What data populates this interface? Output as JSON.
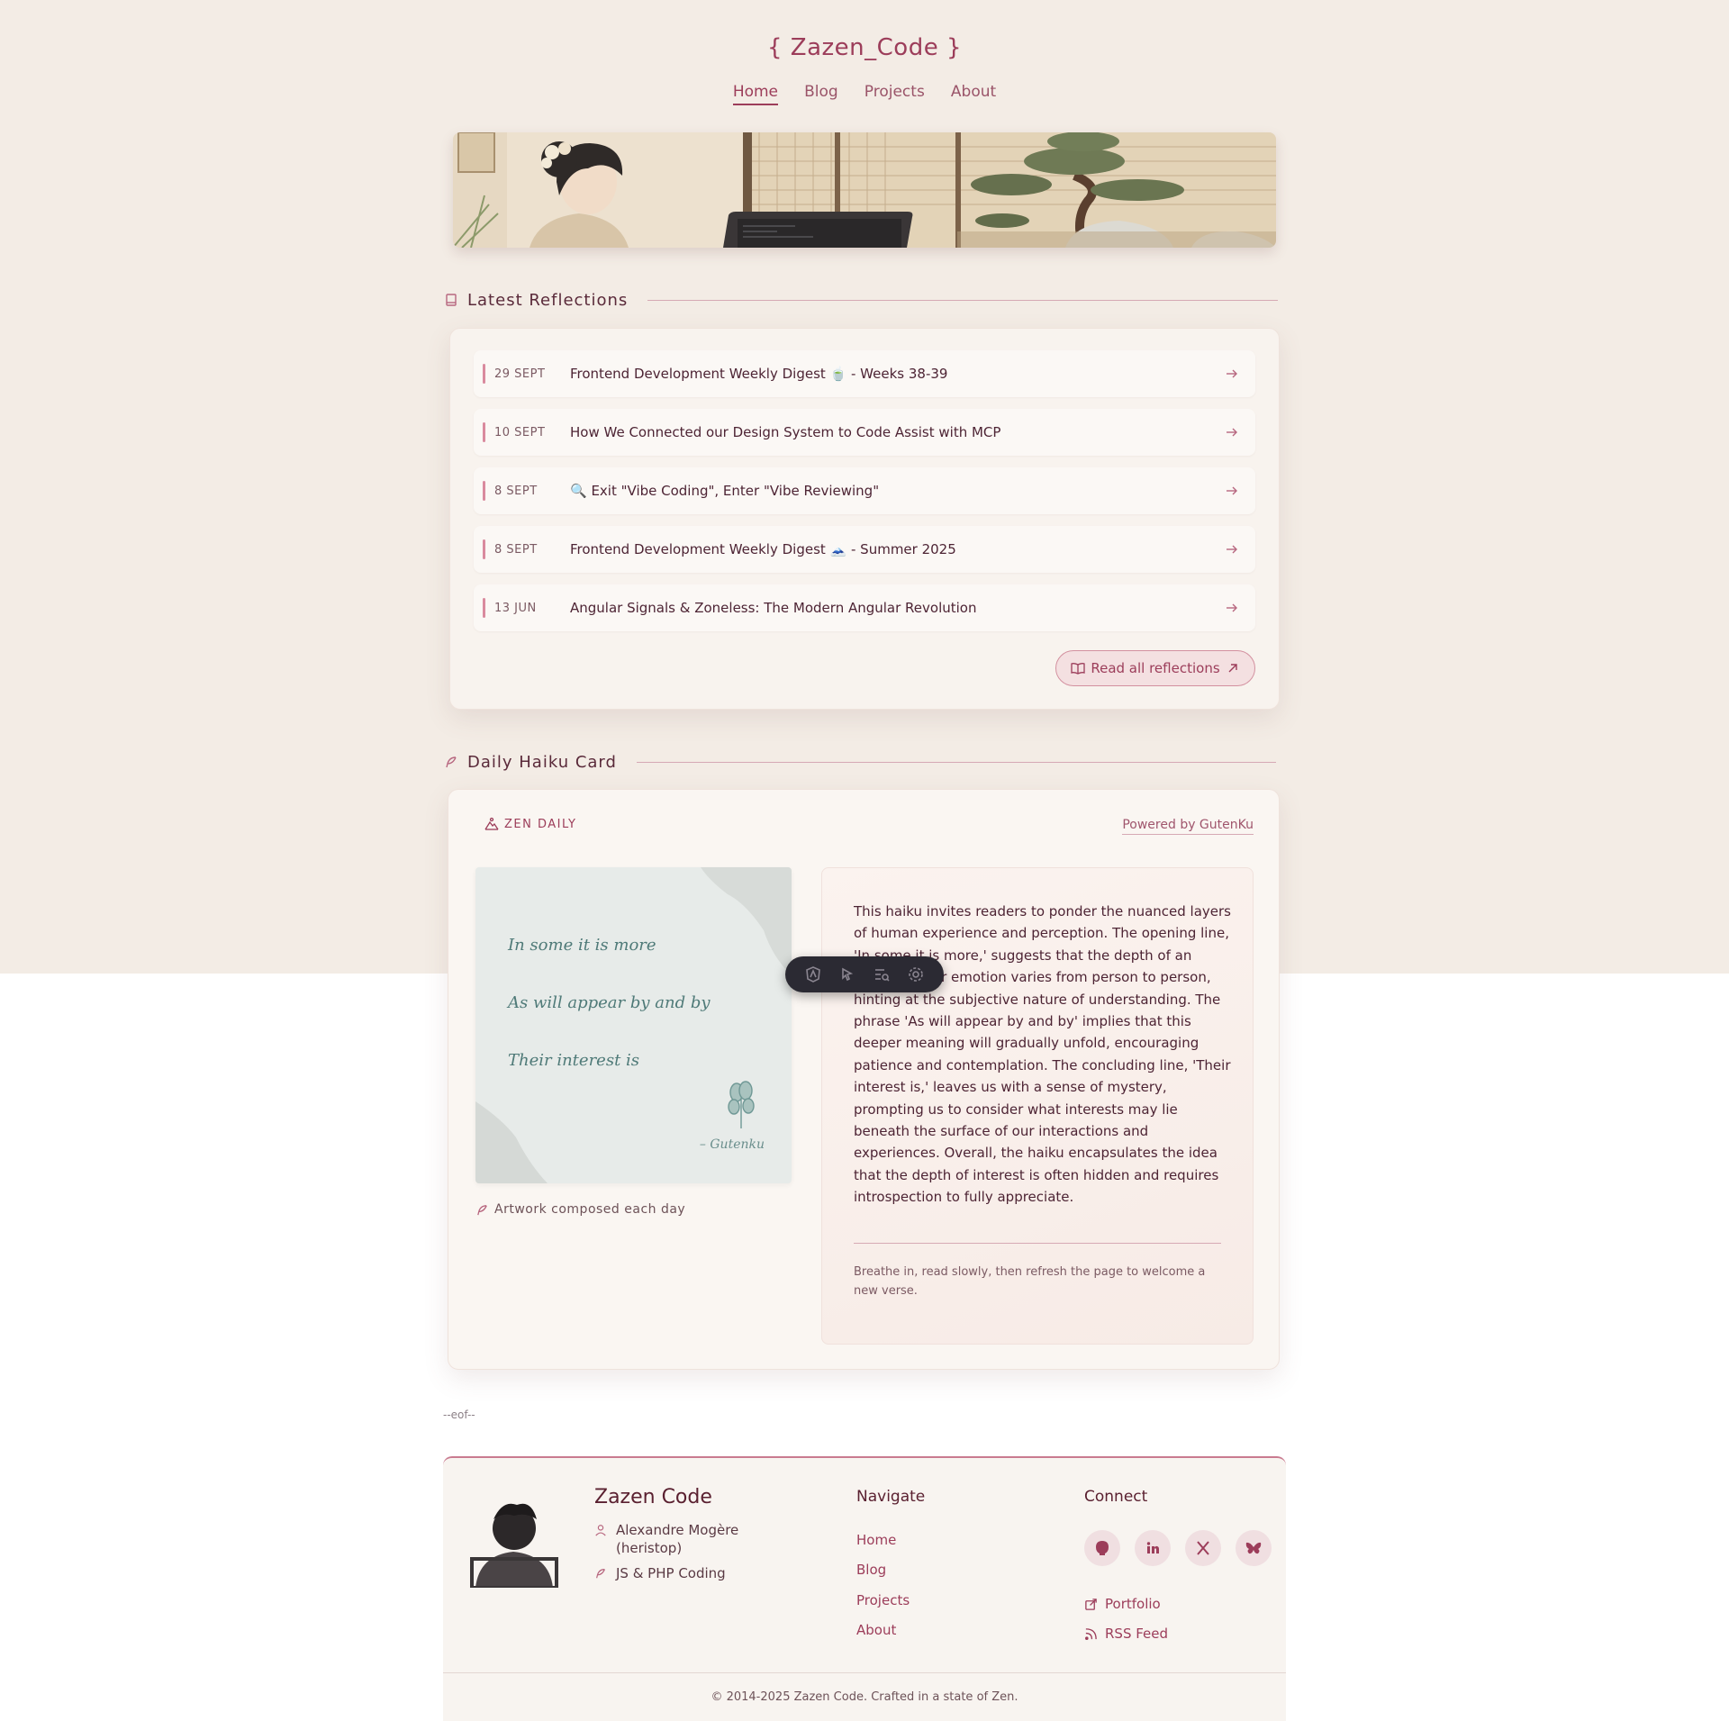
{
  "header": {
    "site_title": "{ Zazen_Code }",
    "nav": [
      "Home",
      "Blog",
      "Projects",
      "About"
    ],
    "active_nav": "Home"
  },
  "reflections": {
    "heading": "Latest Reflections",
    "posts": [
      {
        "date": "29 SEPT",
        "title": "Frontend Development Weekly Digest 🍵 - Weeks 38-39"
      },
      {
        "date": "10 SEPT",
        "title": "How We Connected our Design System to Code Assist with MCP"
      },
      {
        "date": "8 SEPT",
        "title": "🔍 Exit \"Vibe Coding\", Enter \"Vibe Reviewing\""
      },
      {
        "date": "8 SEPT",
        "title": "Frontend Development Weekly Digest 🗻 - Summer 2025"
      },
      {
        "date": "13 JUN",
        "title": "Angular Signals & Zoneless: The Modern Angular Revolution"
      }
    ],
    "read_all_label": "Read all reflections"
  },
  "haiku": {
    "heading": "Daily Haiku Card",
    "badge": "ZEN DAILY",
    "powered_by": "Powered by GutenKu",
    "lines": [
      "In some it is more",
      "As will appear by and by",
      "Their interest is"
    ],
    "signature": "– Gutenku",
    "caption": "Artwork composed each day",
    "interpretation": "This haiku invites readers to ponder the nuanced layers of human experience and perception. The opening line, 'In some it is more,' suggests that the depth of an experience or emotion varies from person to person, hinting at the subjective nature of understanding. The phrase 'As will appear by and by' implies that this deeper meaning will gradually unfold, encouraging patience and contemplation. The concluding line, 'Their interest is,' leaves us with a sense of mystery, prompting us to consider what interests may lie beneath the surface of our interactions and experiences. Overall, the haiku encapsulates the idea that the depth of interest is often hidden and requires introspection to fully appreciate.",
    "note": "Breathe in, read slowly, then refresh the page to welcome a new verse."
  },
  "eof": "--eof--",
  "footer": {
    "name": "Zazen Code",
    "author": "Alexandre Mogère (heristop)",
    "tagline": "JS & PHP Coding",
    "navigate_heading": "Navigate",
    "navigate_links": [
      "Home",
      "Blog",
      "Projects",
      "About"
    ],
    "connect_heading": "Connect",
    "social_icons": [
      "github-icon",
      "linkedin-icon",
      "x-icon",
      "bluesky-icon"
    ],
    "portfolio_label": "Portfolio",
    "rss_label": "RSS Feed",
    "copyright": "© 2014-2025 Zazen Code. Crafted in a state of Zen."
  },
  "colors": {
    "accent": "#9c3d5a",
    "background": "#f3ece5",
    "card": "#f8f3ee",
    "haiku_ink": "#4f7a78",
    "toolbar": "#2b2a33"
  }
}
